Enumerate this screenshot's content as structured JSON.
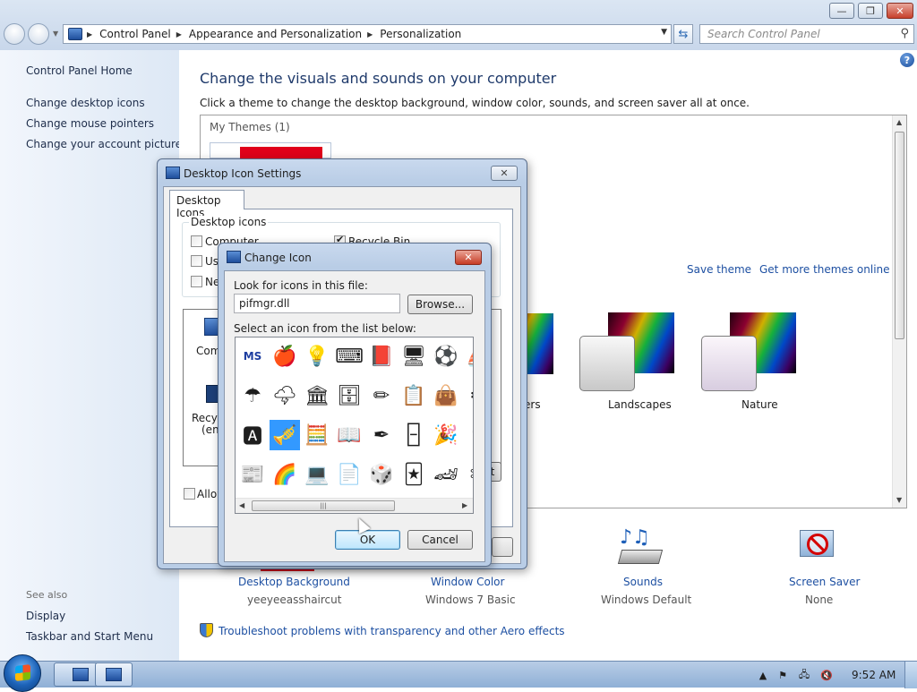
{
  "window": {
    "caption_buttons": {
      "minimize": "—",
      "maximize": "❐",
      "close": "✕"
    }
  },
  "address_bar": {
    "crumbs": [
      "Control Panel",
      "Appearance and Personalization",
      "Personalization"
    ],
    "search_placeholder": "Search Control Panel"
  },
  "left_pane": {
    "home": "Control Panel Home",
    "links": [
      "Change desktop icons",
      "Change mouse pointers",
      "Change your account picture"
    ],
    "see_also_title": "See also",
    "see_also": [
      "Display",
      "Taskbar and Start Menu"
    ]
  },
  "main": {
    "title": "Change the visuals and sounds on your computer",
    "subtitle": "Click a theme to change the desktop background, window color, sounds, and screen saver all at once.",
    "my_themes_label": "My Themes (1)",
    "save_theme": "Save theme",
    "get_more_themes": "Get more themes online",
    "themes": [
      {
        "label": "ers"
      },
      {
        "label": "Landscapes"
      },
      {
        "label": "Nature"
      }
    ],
    "bottom_items": [
      {
        "label": "Desktop Background",
        "sub": "yeeyeeasshaircut"
      },
      {
        "label": "Window Color",
        "sub": "Windows 7 Basic"
      },
      {
        "label": "Sounds",
        "sub": "Windows Default"
      },
      {
        "label": "Screen Saver",
        "sub": "None"
      }
    ],
    "troubleshoot": "Troubleshoot problems with transparency and other Aero effects"
  },
  "desktop_icon_settings": {
    "title": "Desktop Icon Settings",
    "tab": "Desktop Icons",
    "group_label": "Desktop icons",
    "checkboxes": [
      {
        "label": "Computer",
        "checked": false
      },
      {
        "label": "Recycle Bin",
        "checked": true
      },
      {
        "label": "Us",
        "checked": false
      },
      {
        "label": "Ne",
        "checked": false
      }
    ],
    "icon_labels": [
      "Comp",
      "Recyc",
      "(em"
    ],
    "allow_label": "Allow"
  },
  "change_icon": {
    "title": "Change Icon",
    "look_label": "Look for icons in this file:",
    "file_value": "pifmgr.dll",
    "browse": "Browse...",
    "select_label": "Select an icon from the list below:",
    "ok": "OK",
    "cancel": "Cancel",
    "icons": [
      [
        "MS",
        "🍎",
        "💡",
        "⌨",
        "📕",
        "🖥",
        "⚽",
        "⛵"
      ],
      [
        "☂",
        "🌩",
        "🏛",
        "🗄",
        "✏",
        "📋",
        "👜",
        "⚙"
      ],
      [
        "🅰",
        "🎺",
        "🧮",
        "📖",
        "✒",
        "🁣",
        "🎉",
        "🍷"
      ],
      [
        "📰",
        "🌈",
        "💻",
        "📄",
        "🎲",
        "🃏",
        "🏎",
        "✂"
      ]
    ],
    "selected_icon": [
      2,
      1
    ]
  },
  "taskbar": {
    "clock": "9:52 AM"
  }
}
